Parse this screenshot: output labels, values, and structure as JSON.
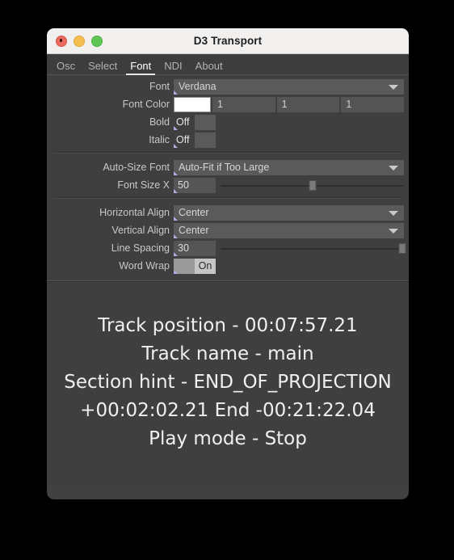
{
  "window": {
    "title": "D3 Transport",
    "traffic_lights": [
      "close-button",
      "minimize-button",
      "zoom-button"
    ]
  },
  "tabs": [
    {
      "label": "Osc",
      "active": false
    },
    {
      "label": "Select",
      "active": false
    },
    {
      "label": "Font",
      "active": true
    },
    {
      "label": "NDI",
      "active": false
    },
    {
      "label": "About",
      "active": false
    }
  ],
  "controls": {
    "font": {
      "label": "Font",
      "value": "Verdana"
    },
    "font_color": {
      "label": "Font Color",
      "swatch": "#ffffff",
      "r": "1",
      "g": "1",
      "b": "1"
    },
    "bold": {
      "label": "Bold",
      "value": "Off",
      "state": "off"
    },
    "italic": {
      "label": "Italic",
      "value": "Off",
      "state": "off"
    },
    "auto_size_font": {
      "label": "Auto-Size Font",
      "value": "Auto-Fit if Too Large"
    },
    "font_size_x": {
      "label": "Font Size X",
      "value": "50",
      "slider_percent": 50
    },
    "horizontal_align": {
      "label": "Horizontal Align",
      "value": "Center"
    },
    "vertical_align": {
      "label": "Vertical Align",
      "value": "Center"
    },
    "line_spacing": {
      "label": "Line Spacing",
      "value": "30",
      "slider_percent": 99
    },
    "word_wrap": {
      "label": "Word Wrap",
      "value": "On",
      "state": "on"
    }
  },
  "display": {
    "lines": [
      "Track position - 00:07:57.21",
      "Track name - main",
      "Section hint - END_OF_PROJECTION",
      "+00:02:02.21 End -00:21:22.04",
      "Play mode - Stop"
    ]
  },
  "colors": {
    "window_chrome": "#f2f0ee",
    "panel_bg": "#3f3f3f",
    "field_bg": "#5a5a5a",
    "marker_accent": "#b9a8e8",
    "text_primary": "#f0f0f0",
    "text_label": "#c8c8c8"
  }
}
